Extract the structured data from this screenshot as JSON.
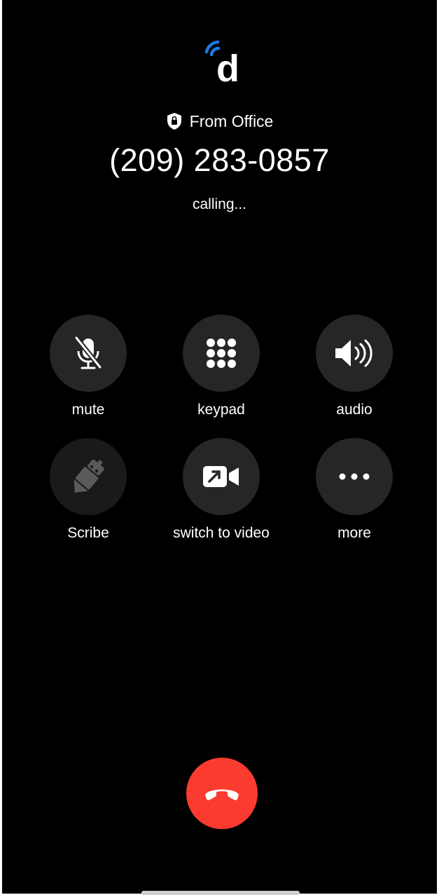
{
  "brand": {
    "logo_letter": "d",
    "logo_arc_color": "#1f7ae0"
  },
  "call": {
    "from_label": "From Office",
    "phone_number": "(209) 283-0857",
    "status": "calling..."
  },
  "controls": {
    "mute": "mute",
    "keypad": "keypad",
    "audio": "audio",
    "scribe": "Scribe",
    "switch_video": "switch to video",
    "more": "more"
  },
  "colors": {
    "background": "#000000",
    "button_bg": "#262626",
    "end_call": "#fb3b30"
  },
  "icons": {
    "mute": "microphone-slash-icon",
    "keypad": "keypad-grid-icon",
    "audio": "speaker-wave-icon",
    "scribe": "robot-pen-icon",
    "switch_video": "video-camera-icon",
    "more": "ellipsis-icon",
    "end_call": "phone-down-icon",
    "from": "shield-lock-icon"
  }
}
